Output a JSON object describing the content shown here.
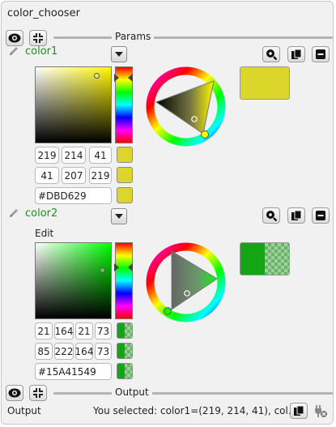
{
  "window": {
    "title": "color_chooser"
  },
  "sections": {
    "params_label": "Params",
    "output_label": "Output"
  },
  "colors": {
    "color1": "#DBD629",
    "color2_base": "#15A415",
    "accent_label": "#1f8f1f"
  },
  "color1": {
    "label": "color1",
    "rgb": [
      "219",
      "214",
      "41"
    ],
    "hsv_row": [
      "41",
      "207",
      "219"
    ],
    "hex": "#DBD629"
  },
  "color2": {
    "label": "color2",
    "edit_label": "Edit",
    "rgba": [
      "21",
      "164",
      "21",
      "73"
    ],
    "hsva_row": [
      "85",
      "222",
      "164",
      "73"
    ],
    "hex": "#15A41549"
  },
  "output": {
    "label": "Output",
    "text": "You selected: color1=(219, 214, 41), col..."
  },
  "icons": {
    "visibility": "eye-icon",
    "collapse": "collapse-arrows-icon",
    "edit": "pencil-icon",
    "dropdown": "triangle-down-icon",
    "zoom": "zoom-in-icon",
    "copy": "copy-icon",
    "remove": "minus-icon",
    "clear_output": "plug-clear-icon"
  }
}
